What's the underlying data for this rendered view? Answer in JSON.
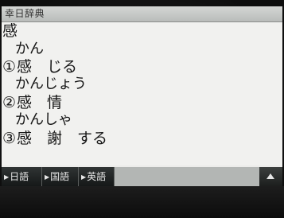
{
  "window": {
    "title": "幸日辞典"
  },
  "entry": {
    "headword": "感",
    "senses": [
      {
        "reading": "かん",
        "marker": "①",
        "word": "感　じる"
      },
      {
        "reading": "かんじょう",
        "marker": "②",
        "word": "感　情"
      },
      {
        "reading": "かんしゃ",
        "marker": "③",
        "word": "感　謝　する"
      }
    ]
  },
  "tabs": [
    {
      "label": "日語"
    },
    {
      "label": "国語"
    },
    {
      "label": "英語"
    }
  ],
  "icons": {
    "tab_arrow": "tab-arrow-icon",
    "scroll_up": "scroll-up-icon"
  },
  "colors": {
    "screen_background": "#f1f1ef",
    "tab_background": "#1f2222",
    "text": "#161616"
  }
}
